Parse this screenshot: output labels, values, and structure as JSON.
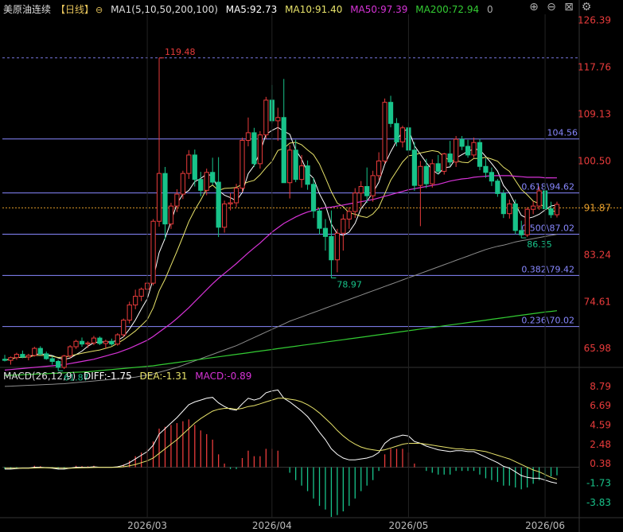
{
  "header": {
    "instrument": "美原油连续",
    "period": "【日线】",
    "ma_params": "MA1(5,10,50,200,100)",
    "ma5": "MA5:92.73",
    "ma10": "MA10:91.40",
    "ma50": "MA50:97.39",
    "ma200": "MA200:72.94",
    "extra": "0"
  },
  "macd_header": {
    "title": "MACD(26,12,9)",
    "diff": "DIFF:-1.75",
    "dea": "DEA:-1.31",
    "macd": "MACD:-0.89"
  },
  "toolbar": {
    "add_icon": "add-icon",
    "zoom_icon": "zoom-icon",
    "close_icon": "close-icon",
    "settings_icon": "gear-icon"
  },
  "colors": {
    "up": "#e83b3b",
    "down": "#18c38a",
    "ma5": "#ffffff",
    "ma10": "#e8e36a",
    "ma50": "#d733d7",
    "ma100": "#8c8c8c",
    "ma200": "#33cc33",
    "fib": "#8888ff",
    "last": "#e09a2a"
  },
  "chart_data": {
    "type": "candlestick",
    "x_ticks": [
      "2026/03",
      "2026/04",
      "2026/05",
      "2026/06"
    ],
    "price_axis": [
      "126.39",
      "117.76",
      "109.13",
      "100.50",
      "91.87",
      "83.24",
      "74.61",
      "65.98"
    ],
    "ylim": [
      62.5,
      127.5
    ],
    "macd_axis": [
      "8.79",
      "6.69",
      "4.59",
      "2.48",
      "0.38",
      "-1.73",
      "-3.83"
    ],
    "macd_ylim": [
      -5.4,
      9.3
    ],
    "last_price": "91.87",
    "annotations": [
      {
        "label": "119.48",
        "value": 119.48
      },
      {
        "label": "78.97",
        "value": 78.97
      },
      {
        "label": "61.87",
        "value": 61.87
      },
      {
        "label": "86.35",
        "value": 86.35
      }
    ],
    "fib_levels": [
      {
        "label": "104.56",
        "value": 104.56
      },
      {
        "label": "0.618\\94.62",
        "value": 94.62
      },
      {
        "label": "0.500\\87.02",
        "value": 87.02
      },
      {
        "label": "0.382\\79.42",
        "value": 79.42
      },
      {
        "label": "0.236\\70.02",
        "value": 70.02
      }
    ],
    "candles": [
      [
        64.0,
        64.8,
        63.6,
        63.8
      ],
      [
        63.8,
        64.5,
        63.0,
        64.3
      ],
      [
        64.3,
        65.2,
        63.9,
        64.9
      ],
      [
        64.9,
        65.6,
        64.2,
        64.4
      ],
      [
        64.4,
        65.0,
        63.8,
        64.7
      ],
      [
        64.7,
        66.3,
        64.5,
        66.0
      ],
      [
        66.0,
        66.4,
        64.7,
        65.0
      ],
      [
        65.0,
        65.4,
        63.9,
        64.1
      ],
      [
        64.1,
        64.6,
        63.0,
        63.6
      ],
      [
        63.6,
        63.9,
        61.87,
        62.5
      ],
      [
        62.5,
        64.8,
        62.2,
        64.6
      ],
      [
        64.6,
        66.6,
        64.2,
        66.3
      ],
      [
        66.3,
        67.6,
        65.9,
        67.3
      ],
      [
        67.3,
        68.0,
        66.3,
        66.8
      ],
      [
        66.8,
        67.3,
        66.1,
        67.0
      ],
      [
        67.0,
        68.3,
        66.6,
        67.9
      ],
      [
        67.9,
        68.2,
        66.6,
        66.9
      ],
      [
        66.9,
        67.6,
        66.0,
        67.3
      ],
      [
        67.3,
        67.8,
        66.5,
        66.8
      ],
      [
        66.8,
        68.8,
        66.5,
        68.5
      ],
      [
        68.5,
        71.5,
        68.1,
        71.2
      ],
      [
        71.2,
        74.6,
        70.6,
        74.0
      ],
      [
        74.0,
        76.8,
        73.2,
        75.6
      ],
      [
        75.6,
        77.2,
        74.7,
        76.9
      ],
      [
        76.9,
        78.3,
        75.8,
        78.0
      ],
      [
        78.0,
        89.8,
        77.6,
        89.4
      ],
      [
        89.4,
        119.48,
        88.4,
        98.2
      ],
      [
        98.2,
        99.4,
        86.0,
        88.9
      ],
      [
        88.9,
        92.8,
        88.0,
        92.2
      ],
      [
        92.2,
        95.3,
        91.1,
        94.4
      ],
      [
        94.4,
        98.7,
        93.5,
        98.2
      ],
      [
        98.2,
        102.5,
        97.2,
        101.6
      ],
      [
        101.6,
        102.6,
        95.8,
        97.1
      ],
      [
        97.1,
        98.5,
        94.0,
        95.1
      ],
      [
        95.1,
        99.1,
        94.2,
        98.4
      ],
      [
        98.4,
        101.1,
        96.1,
        96.6
      ],
      [
        96.6,
        101.2,
        86.5,
        88.3
      ],
      [
        88.3,
        93.2,
        87.3,
        92.6
      ],
      [
        92.6,
        94.6,
        91.4,
        92.8
      ],
      [
        92.8,
        96.3,
        92.0,
        95.5
      ],
      [
        95.5,
        104.8,
        94.8,
        104.3
      ],
      [
        104.3,
        108.5,
        103.2,
        105.7
      ],
      [
        105.7,
        106.6,
        99.4,
        100.0
      ],
      [
        100.0,
        106.0,
        99.1,
        105.3
      ],
      [
        105.3,
        112.3,
        104.6,
        111.7
      ],
      [
        111.7,
        114.5,
        107.4,
        107.9
      ],
      [
        107.9,
        110.3,
        104.2,
        108.5
      ],
      [
        108.5,
        115.6,
        99.6,
        96.5
      ],
      [
        96.5,
        103.4,
        93.6,
        102.5
      ],
      [
        102.5,
        104.4,
        96.6,
        97.1
      ],
      [
        97.1,
        101.6,
        95.6,
        99.6
      ],
      [
        99.6,
        100.6,
        95.2,
        96.2
      ],
      [
        96.2,
        97.4,
        90.0,
        91.3
      ],
      [
        91.3,
        91.8,
        87.0,
        88.1
      ],
      [
        88.1,
        89.8,
        84.0,
        86.6
      ],
      [
        86.6,
        91.4,
        78.97,
        82.3
      ],
      [
        82.3,
        88.0,
        80.0,
        87.2
      ],
      [
        87.2,
        90.7,
        84.0,
        89.8
      ],
      [
        89.8,
        92.0,
        88.0,
        91.2
      ],
      [
        91.2,
        95.5,
        90.0,
        94.6
      ],
      [
        94.6,
        96.8,
        92.1,
        95.8
      ],
      [
        95.8,
        99.3,
        92.8,
        94.1
      ],
      [
        94.1,
        98.7,
        93.0,
        97.8
      ],
      [
        97.8,
        102.1,
        97.0,
        100.5
      ],
      [
        100.5,
        112.0,
        100.0,
        111.3
      ],
      [
        111.3,
        112.5,
        106.7,
        107.4
      ],
      [
        107.4,
        108.4,
        103.2,
        104.0
      ],
      [
        104.0,
        107.0,
        103.0,
        106.6
      ],
      [
        106.6,
        107.6,
        102.0,
        102.5
      ],
      [
        102.5,
        104.0,
        95.0,
        96.0
      ],
      [
        96.0,
        100.5,
        88.5,
        99.5
      ],
      [
        99.5,
        100.9,
        95.5,
        96.3
      ],
      [
        96.3,
        100.8,
        95.6,
        100.0
      ],
      [
        100.0,
        101.6,
        98.0,
        98.6
      ],
      [
        98.6,
        102.0,
        98.0,
        101.8
      ],
      [
        101.8,
        104.2,
        99.6,
        100.3
      ],
      [
        100.3,
        105.1,
        99.4,
        104.5
      ],
      [
        104.5,
        105.1,
        102.5,
        103.2
      ],
      [
        103.2,
        104.4,
        101.1,
        101.6
      ],
      [
        101.6,
        104.8,
        101.1,
        103.9
      ],
      [
        103.9,
        104.6,
        98.8,
        99.5
      ],
      [
        99.5,
        101.0,
        97.4,
        98.4
      ],
      [
        98.4,
        99.3,
        95.9,
        96.8
      ],
      [
        96.8,
        97.2,
        93.9,
        94.5
      ],
      [
        94.5,
        95.2,
        90.0,
        90.8
      ],
      [
        90.8,
        93.4,
        89.9,
        92.6
      ],
      [
        92.6,
        93.4,
        87.0,
        87.7
      ],
      [
        87.7,
        89.5,
        86.35,
        86.9
      ],
      [
        86.9,
        92.0,
        86.5,
        91.6
      ],
      [
        91.6,
        93.1,
        90.7,
        92.2
      ],
      [
        92.2,
        95.8,
        91.5,
        95.0
      ],
      [
        95.0,
        96.2,
        91.2,
        91.7
      ],
      [
        91.7,
        93.0,
        90.0,
        90.6
      ],
      [
        90.6,
        93.0,
        90.1,
        92.5
      ]
    ],
    "ma_series": [
      {
        "name": "MA5",
        "key": "ma5",
        "w": 1.0
      },
      {
        "name": "MA10",
        "key": "ma10",
        "w": 1.0
      },
      {
        "name": "MA50",
        "key": "ma50",
        "w": 1.2
      },
      {
        "name": "MA100",
        "key": "ma100",
        "w": 1.0
      },
      {
        "name": "MA200",
        "key": "ma200",
        "w": 1.2
      }
    ],
    "ma50_values": [
      62,
      62.1,
      62.2,
      62.3,
      62.4,
      62.5,
      62.6,
      62.7,
      62.8,
      62.9,
      63,
      63.2,
      63.4,
      63.6,
      63.8,
      64,
      64.3,
      64.6,
      64.9,
      65.2,
      65.6,
      66,
      66.5,
      67,
      67.5,
      68.2,
      69,
      69.8,
      70.6,
      71.5,
      72.5,
      73.5,
      74.6,
      75.7,
      76.8,
      77.9,
      78.9,
      79.8,
      80.7,
      81.6,
      82.6,
      83.6,
      84.5,
      85.4,
      86.4,
      87.4,
      88.2,
      89,
      89.6,
      90.2,
      90.7,
      91.1,
      91.4,
      91.7,
      91.9,
      92,
      92.2,
      92.4,
      92.6,
      92.8,
      93,
      93.2,
      93.4,
      93.7,
      94,
      94.3,
      94.6,
      94.9,
      95.2,
      95.4,
      95.6,
      95.8,
      96,
      96.2,
      96.5,
      96.8,
      97,
      97.2,
      97.3,
      97.5,
      97.6,
      97.7,
      97.8,
      97.8,
      97.8,
      97.8,
      97.7,
      97.6,
      97.5,
      97.5,
      97.5,
      97.4,
      97.4,
      97.39
    ],
    "ma100_values": [
      59,
      59.05,
      59.1,
      59.15,
      59.2,
      59.25,
      59.3,
      59.35,
      59.4,
      59.45,
      59.5,
      59.6,
      59.7,
      59.8,
      59.9,
      60,
      60.1,
      60.2,
      60.3,
      60.4,
      60.5,
      60.6,
      60.7,
      60.9,
      61.1,
      61.3,
      61.6,
      61.9,
      62.2,
      62.5,
      62.9,
      63.3,
      63.7,
      64.1,
      64.5,
      64.9,
      65.3,
      65.7,
      66.1,
      66.5,
      67,
      67.5,
      68,
      68.5,
      69,
      69.5,
      70,
      70.5,
      71,
      71.4,
      71.8,
      72.2,
      72.6,
      73,
      73.4,
      73.8,
      74.2,
      74.6,
      75,
      75.4,
      75.8,
      76.2,
      76.6,
      77,
      77.4,
      77.8,
      78.2,
      78.6,
      79,
      79.4,
      79.8,
      80.2,
      80.6,
      81,
      81.4,
      81.8,
      82.2,
      82.6,
      83,
      83.4,
      83.8,
      84.2,
      84.5,
      84.8,
      85,
      85.3,
      85.6,
      85.8,
      86,
      86.2,
      86.4,
      86.6,
      86.8,
      87.0
    ],
    "ma200_values": [
      61.0,
      61.05,
      61.1,
      61.15,
      61.2,
      61.25,
      61.3,
      61.35,
      61.4,
      61.45,
      61.5,
      61.55,
      61.6,
      61.65,
      61.7,
      61.8,
      61.9,
      62,
      62.1,
      62.2,
      62.3,
      62.4,
      62.5,
      62.6,
      62.7,
      62.8,
      62.95,
      63.1,
      63.25,
      63.4,
      63.55,
      63.7,
      63.85,
      64,
      64.15,
      64.3,
      64.45,
      64.6,
      64.75,
      64.9,
      65.05,
      65.2,
      65.35,
      65.5,
      65.65,
      65.8,
      65.95,
      66.1,
      66.25,
      66.4,
      66.55,
      66.7,
      66.85,
      67,
      67.15,
      67.3,
      67.45,
      67.6,
      67.75,
      67.9,
      68.05,
      68.2,
      68.35,
      68.5,
      68.65,
      68.8,
      68.95,
      69.1,
      69.25,
      69.4,
      69.55,
      69.7,
      69.85,
      70,
      70.15,
      70.3,
      70.45,
      70.6,
      70.75,
      70.9,
      71.05,
      71.2,
      71.35,
      71.5,
      71.65,
      71.8,
      71.95,
      72.1,
      72.25,
      72.4,
      72.55,
      72.7,
      72.8,
      72.94
    ],
    "diff_values": [
      -0.2,
      -0.2,
      -0.15,
      -0.1,
      -0.1,
      0,
      0,
      -0.05,
      -0.1,
      -0.2,
      -0.2,
      -0.1,
      0,
      0,
      0,
      0.05,
      0,
      0,
      0,
      0.05,
      0.2,
      0.5,
      0.9,
      1.3,
      1.7,
      2.4,
      3.6,
      4.2,
      4.8,
      5.4,
      6.1,
      6.8,
      7.1,
      7.3,
      7.5,
      7.6,
      7.0,
      6.6,
      6.3,
      6.2,
      6.9,
      7.5,
      7.3,
      7.5,
      8.1,
      8.3,
      8.4,
      7.5,
      7.1,
      6.6,
      6.1,
      5.5,
      4.7,
      3.8,
      3.0,
      2.0,
      1.4,
      1.0,
      0.8,
      0.8,
      0.9,
      1.0,
      1.2,
      1.6,
      2.6,
      3.1,
      3.3,
      3.5,
      3.4,
      2.8,
      2.6,
      2.3,
      2.1,
      1.9,
      1.8,
      1.7,
      1.8,
      1.8,
      1.7,
      1.7,
      1.4,
      1.1,
      0.8,
      0.5,
      0.1,
      -0.1,
      -0.5,
      -0.9,
      -1.1,
      -1.2,
      -1.2,
      -1.4,
      -1.6,
      -1.75
    ],
    "dea_values": [
      -0.1,
      -0.1,
      -0.1,
      -0.1,
      -0.1,
      -0.08,
      -0.06,
      -0.05,
      -0.06,
      -0.09,
      -0.1,
      -0.1,
      -0.08,
      -0.06,
      -0.05,
      -0.03,
      -0.02,
      -0.02,
      -0.01,
      0,
      0.05,
      0.15,
      0.3,
      0.5,
      0.7,
      1.0,
      1.5,
      2.0,
      2.5,
      3.0,
      3.6,
      4.2,
      4.8,
      5.3,
      5.7,
      6.1,
      6.3,
      6.4,
      6.4,
      6.3,
      6.4,
      6.6,
      6.7,
      6.9,
      7.1,
      7.3,
      7.5,
      7.5,
      7.4,
      7.3,
      7.1,
      6.8,
      6.4,
      5.9,
      5.3,
      4.7,
      4.0,
      3.4,
      2.9,
      2.5,
      2.2,
      2.0,
      1.9,
      1.8,
      1.9,
      2.1,
      2.3,
      2.5,
      2.6,
      2.6,
      2.6,
      2.5,
      2.4,
      2.3,
      2.2,
      2.1,
      2.0,
      2.0,
      1.9,
      1.9,
      1.8,
      1.7,
      1.5,
      1.3,
      1.1,
      0.9,
      0.6,
      0.3,
      0,
      -0.3,
      -0.5,
      -0.8,
      -1.1,
      -1.31
    ]
  }
}
